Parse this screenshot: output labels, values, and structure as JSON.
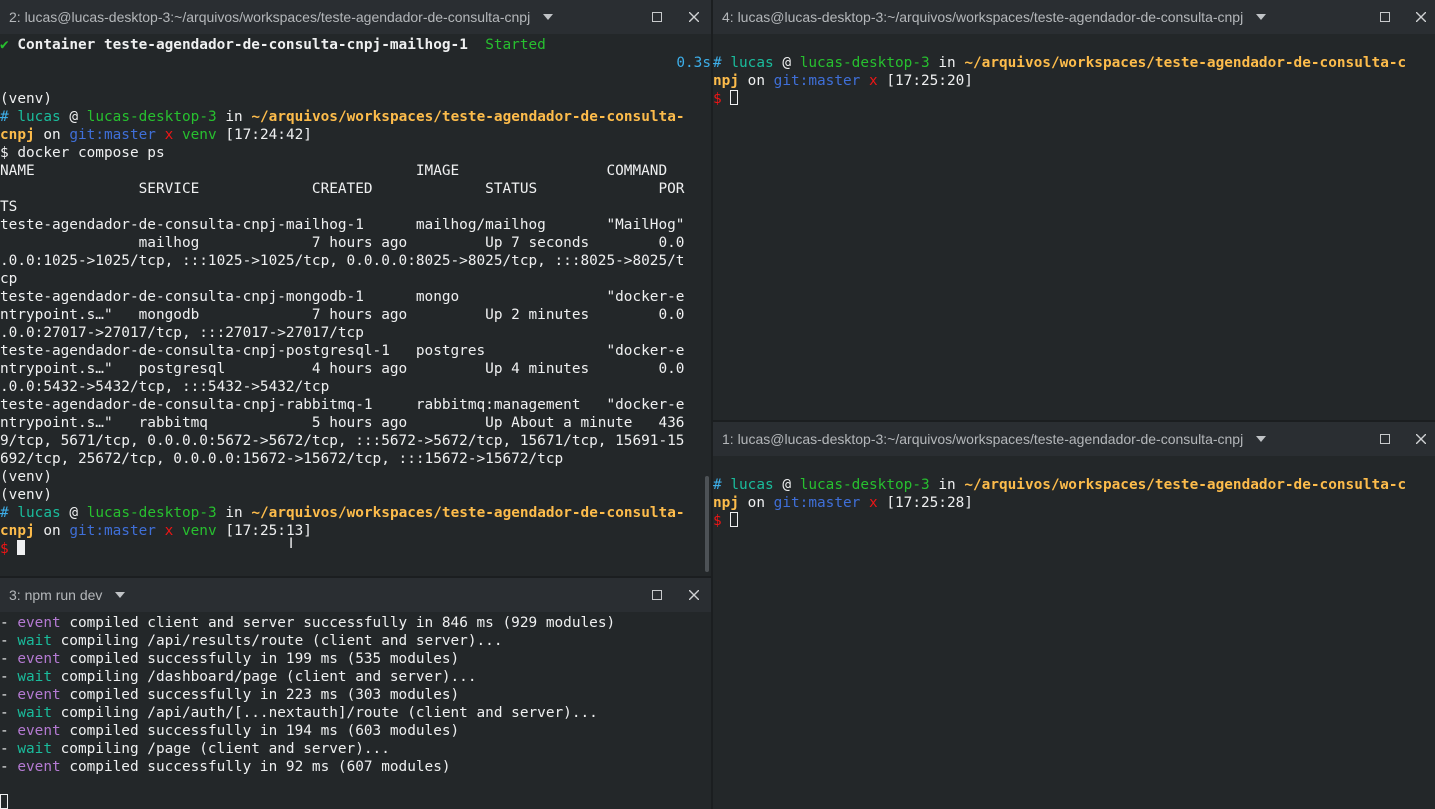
{
  "panes": {
    "top_left": {
      "title": "2: lucas@lucas-desktop-3:~/arquivos/workspaces/teste-agendador-de-consulta-cnpj",
      "container_check": "✔",
      "container_line": " Container teste-agendador-de-consulta-cnpj-mailhog-1  ",
      "container_status": "Started",
      "elapsed": "0.3s",
      "venv": "(venv)",
      "prompt1": {
        "hash": "#",
        "user": "lucas",
        "at": "@",
        "host": "lucas-desktop-3",
        "in": "in",
        "path_a": "~/arquivos/workspaces/teste-agendador-de-consulta-",
        "path_b": "cnpj",
        "on": "on",
        "git": "git:master",
        "x": "x",
        "venv_tag": "venv",
        "time": "[17:24:42]"
      },
      "command": "$ docker compose ps",
      "table_lines": [
        "NAME                                            IMAGE                 COMMAND",
        "                SERVICE             CREATED             STATUS              POR",
        "TS",
        "teste-agendador-de-consulta-cnpj-mailhog-1      mailhog/mailhog       \"MailHog\"",
        "                mailhog             7 hours ago         Up 7 seconds        0.0",
        ".0.0:1025->1025/tcp, :::1025->1025/tcp, 0.0.0.0:8025->8025/tcp, :::8025->8025/t",
        "cp",
        "teste-agendador-de-consulta-cnpj-mongodb-1      mongo                 \"docker-e",
        "ntrypoint.s…\"   mongodb             7 hours ago         Up 2 minutes        0.0",
        ".0.0:27017->27017/tcp, :::27017->27017/tcp",
        "teste-agendador-de-consulta-cnpj-postgresql-1   postgres              \"docker-e",
        "ntrypoint.s…\"   postgresql          4 hours ago         Up 4 minutes        0.0",
        ".0.0:5432->5432/tcp, :::5432->5432/tcp",
        "teste-agendador-de-consulta-cnpj-rabbitmq-1     rabbitmq:management   \"docker-e",
        "ntrypoint.s…\"   rabbitmq            5 hours ago         Up About a minute   436",
        "9/tcp, 5671/tcp, 0.0.0.0:5672->5672/tcp, :::5672->5672/tcp, 15671/tcp, 15691-15",
        "692/tcp, 25672/tcp, 0.0.0.0:15672->15672/tcp, :::15672->15672/tcp"
      ],
      "prompt2": {
        "time": "[17:25:13]"
      },
      "dollar": "$"
    },
    "bottom_left": {
      "title": "3: npm run dev",
      "log_lines": [
        {
          "dash": "- ",
          "kind": "event",
          "text": " compiled client and server successfully in 846 ms (929 modules)"
        },
        {
          "dash": "- ",
          "kind": "wait",
          "text": " compiling /api/results/route (client and server)..."
        },
        {
          "dash": "- ",
          "kind": "event",
          "text": " compiled successfully in 199 ms (535 modules)"
        },
        {
          "dash": "- ",
          "kind": "wait",
          "text": " compiling /dashboard/page (client and server)..."
        },
        {
          "dash": "- ",
          "kind": "event",
          "text": " compiled successfully in 223 ms (303 modules)"
        },
        {
          "dash": "- ",
          "kind": "wait",
          "text": " compiling /api/auth/[...nextauth]/route (client and server)..."
        },
        {
          "dash": "- ",
          "kind": "event",
          "text": " compiled successfully in 194 ms (603 modules)"
        },
        {
          "dash": "- ",
          "kind": "wait",
          "text": " compiling /page (client and server)..."
        },
        {
          "dash": "- ",
          "kind": "event",
          "text": " compiled successfully in 92 ms (607 modules)"
        }
      ]
    },
    "top_right": {
      "title": "4: lucas@lucas-desktop-3:~/arquivos/workspaces/teste-agendador-de-consulta-cnpj",
      "path_a": "~/arquivos/workspaces/teste-agendador-de-consulta-c",
      "path_b": "npj",
      "time": "[17:25:20]"
    },
    "bottom_right": {
      "title": "1: lucas@lucas-desktop-3:~/arquivos/workspaces/teste-agendador-de-consulta-cnpj",
      "path_a": "~/arquivos/workspaces/teste-agendador-de-consulta-c",
      "path_b": "npj",
      "time": "[17:25:28]"
    }
  },
  "icons": {
    "chevron": "chevron-down-icon",
    "maximize": "maximize-icon",
    "close": "close-icon"
  },
  "colors": {
    "background": "#232729",
    "tabbar": "#2a2e32",
    "green": "#27c02f",
    "blue": "#3daee9",
    "yellow": "#fdbc4b",
    "red": "#ed1515",
    "magenta": "#b47ad2",
    "cyan": "#1abc9c"
  }
}
